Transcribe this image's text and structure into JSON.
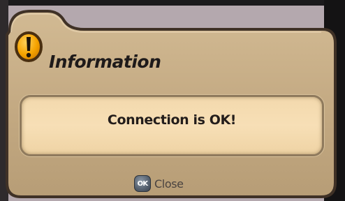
{
  "dialog": {
    "title": "Information",
    "message": "Connection is OK!",
    "icon": "exclamation-icon",
    "close_button": {
      "badge": "OK",
      "label": "Close"
    }
  },
  "colors": {
    "panel": "#c4ab84",
    "message_box": "#f5dcb2",
    "icon_fill": "#f3a200",
    "border": "#4a3a2c"
  }
}
